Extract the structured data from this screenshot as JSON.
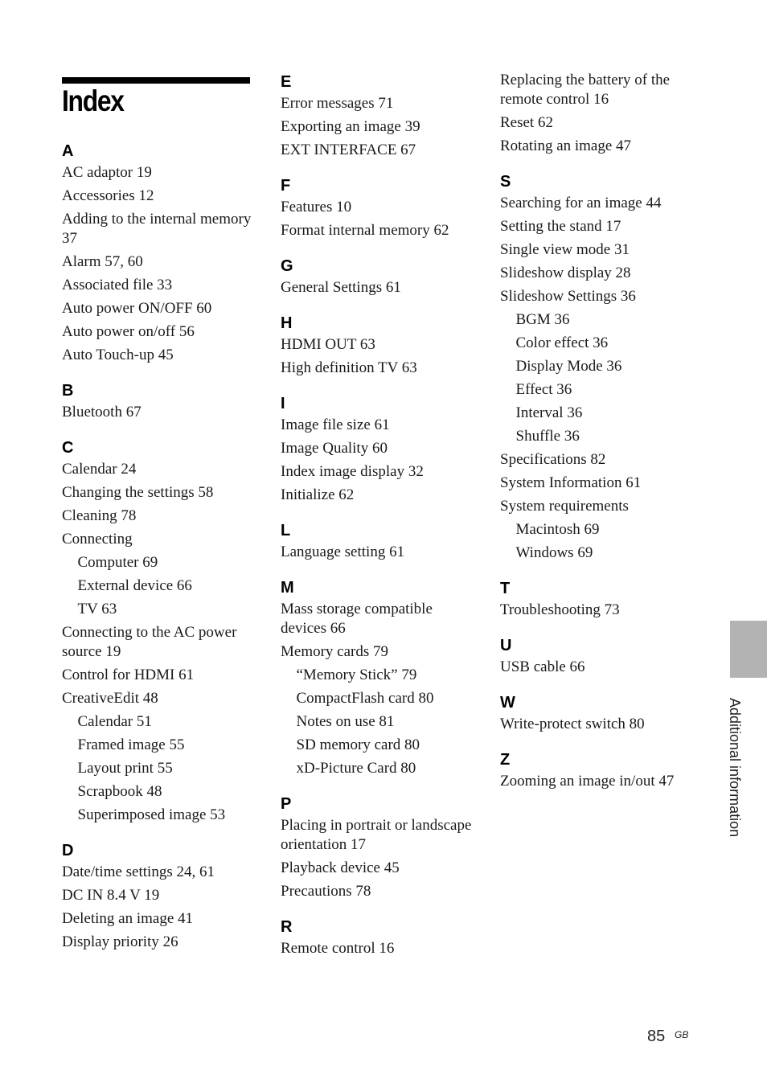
{
  "title": "Index",
  "side_tab_label": "Additional information",
  "page_number": "85",
  "page_region": "GB",
  "columns": [
    [
      {
        "letter": "A",
        "entries": [
          {
            "text": "AC adaptor 19",
            "sub": false
          },
          {
            "text": "Accessories 12",
            "sub": false
          },
          {
            "text": "Adding to the internal memory 37",
            "sub": false
          },
          {
            "text": "Alarm 57, 60",
            "sub": false
          },
          {
            "text": "Associated file 33",
            "sub": false
          },
          {
            "text": "Auto power ON/OFF 60",
            "sub": false
          },
          {
            "text": "Auto power on/off 56",
            "sub": false
          },
          {
            "text": "Auto Touch-up 45",
            "sub": false
          }
        ]
      },
      {
        "letter": "B",
        "entries": [
          {
            "text": "Bluetooth 67",
            "sub": false
          }
        ]
      },
      {
        "letter": "C",
        "entries": [
          {
            "text": "Calendar 24",
            "sub": false
          },
          {
            "text": "Changing the settings 58",
            "sub": false
          },
          {
            "text": "Cleaning 78",
            "sub": false
          },
          {
            "text": "Connecting",
            "sub": false
          },
          {
            "text": "Computer 69",
            "sub": true
          },
          {
            "text": "External device 66",
            "sub": true
          },
          {
            "text": "TV 63",
            "sub": true
          },
          {
            "text": "Connecting to the AC power source 19",
            "sub": false
          },
          {
            "text": "Control for HDMI 61",
            "sub": false
          },
          {
            "text": "CreativeEdit 48",
            "sub": false
          },
          {
            "text": "Calendar 51",
            "sub": true
          },
          {
            "text": "Framed image 55",
            "sub": true
          },
          {
            "text": "Layout print 55",
            "sub": true
          },
          {
            "text": "Scrapbook 48",
            "sub": true
          },
          {
            "text": "Superimposed image 53",
            "sub": true
          }
        ]
      },
      {
        "letter": "D",
        "entries": [
          {
            "text": "Date/time settings 24, 61",
            "sub": false
          },
          {
            "text": "DC IN 8.4 V 19",
            "sub": false
          },
          {
            "text": "Deleting an image 41",
            "sub": false
          },
          {
            "text": "Display priority 26",
            "sub": false
          }
        ]
      }
    ],
    [
      {
        "letter": "E",
        "entries": [
          {
            "text": "Error messages 71",
            "sub": false
          },
          {
            "text": "Exporting an image 39",
            "sub": false
          },
          {
            "text": "EXT INTERFACE 67",
            "sub": false
          }
        ]
      },
      {
        "letter": "F",
        "entries": [
          {
            "text": "Features 10",
            "sub": false
          },
          {
            "text": "Format internal memory 62",
            "sub": false
          }
        ]
      },
      {
        "letter": "G",
        "entries": [
          {
            "text": "General Settings 61",
            "sub": false
          }
        ]
      },
      {
        "letter": "H",
        "entries": [
          {
            "text": "HDMI OUT 63",
            "sub": false
          },
          {
            "text": "High definition TV 63",
            "sub": false
          }
        ]
      },
      {
        "letter": "I",
        "entries": [
          {
            "text": "Image file size 61",
            "sub": false
          },
          {
            "text": "Image Quality 60",
            "sub": false
          },
          {
            "text": "Index image display 32",
            "sub": false
          },
          {
            "text": "Initialize 62",
            "sub": false
          }
        ]
      },
      {
        "letter": "L",
        "entries": [
          {
            "text": "Language setting 61",
            "sub": false
          }
        ]
      },
      {
        "letter": "M",
        "entries": [
          {
            "text": "Mass storage compatible devices 66",
            "sub": false
          },
          {
            "text": "Memory cards 79",
            "sub": false
          },
          {
            "text": "“Memory Stick” 79",
            "sub": true
          },
          {
            "text": "CompactFlash card 80",
            "sub": true
          },
          {
            "text": "Notes on use 81",
            "sub": true
          },
          {
            "text": "SD memory card 80",
            "sub": true
          },
          {
            "text": "xD-Picture Card 80",
            "sub": true
          }
        ]
      },
      {
        "letter": "P",
        "entries": [
          {
            "text": "Placing in portrait or landscape orientation 17",
            "sub": false
          },
          {
            "text": "Playback device 45",
            "sub": false
          },
          {
            "text": "Precautions 78",
            "sub": false
          }
        ]
      },
      {
        "letter": "R",
        "entries": [
          {
            "text": "Remote control 16",
            "sub": false
          }
        ]
      }
    ],
    [
      {
        "letter": "",
        "entries": [
          {
            "text": "Replacing the battery of the remote control 16",
            "sub": false
          },
          {
            "text": "Reset 62",
            "sub": false
          },
          {
            "text": "Rotating an image 47",
            "sub": false
          }
        ]
      },
      {
        "letter": "S",
        "entries": [
          {
            "text": "Searching for an image 44",
            "sub": false
          },
          {
            "text": "Setting the stand 17",
            "sub": false
          },
          {
            "text": "Single view mode 31",
            "sub": false
          },
          {
            "text": "Slideshow display 28",
            "sub": false
          },
          {
            "text": "Slideshow Settings 36",
            "sub": false
          },
          {
            "text": "BGM 36",
            "sub": true
          },
          {
            "text": "Color effect 36",
            "sub": true
          },
          {
            "text": "Display Mode 36",
            "sub": true
          },
          {
            "text": "Effect 36",
            "sub": true
          },
          {
            "text": "Interval 36",
            "sub": true
          },
          {
            "text": "Shuffle 36",
            "sub": true
          },
          {
            "text": "Specifications 82",
            "sub": false
          },
          {
            "text": "System Information 61",
            "sub": false
          },
          {
            "text": "System requirements",
            "sub": false
          },
          {
            "text": "Macintosh 69",
            "sub": true
          },
          {
            "text": "Windows 69",
            "sub": true
          }
        ]
      },
      {
        "letter": "T",
        "entries": [
          {
            "text": "Troubleshooting 73",
            "sub": false
          }
        ]
      },
      {
        "letter": "U",
        "entries": [
          {
            "text": "USB cable 66",
            "sub": false
          }
        ]
      },
      {
        "letter": "W",
        "entries": [
          {
            "text": "Write-protect switch 80",
            "sub": false
          }
        ]
      },
      {
        "letter": "Z",
        "entries": [
          {
            "text": "Zooming an image in/out 47",
            "sub": false
          }
        ]
      }
    ]
  ]
}
